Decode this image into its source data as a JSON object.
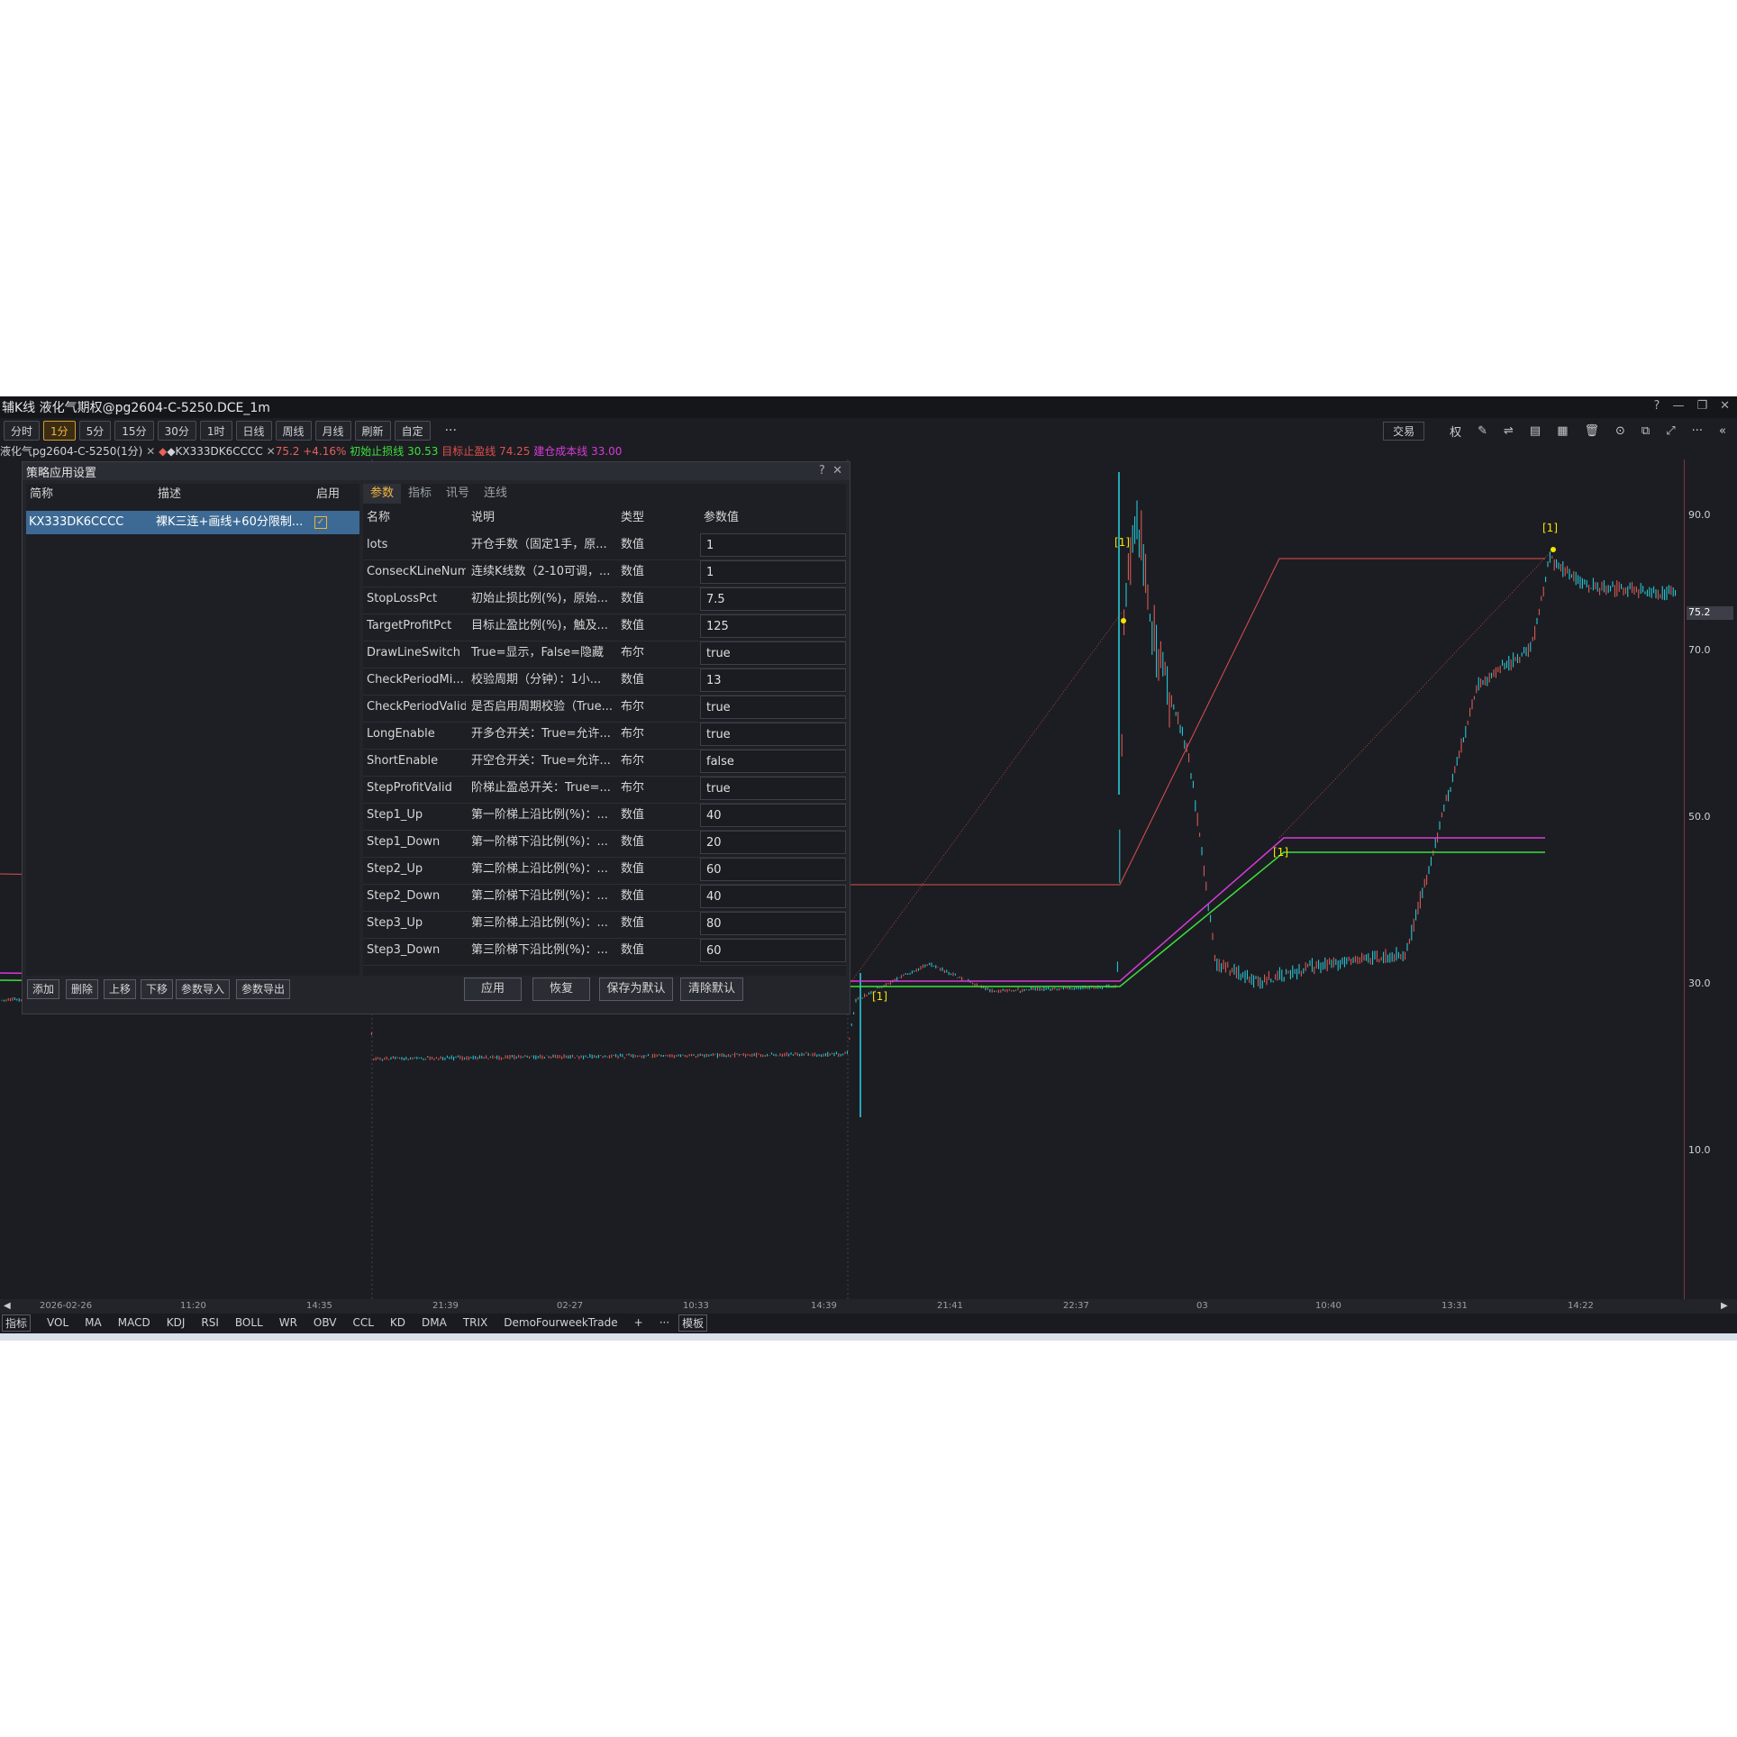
{
  "window": {
    "title": "辅K线 液化气期权@pg2604-C-5250.DCE_1m",
    "controls": [
      "?",
      "—",
      "❐",
      "✕"
    ]
  },
  "toolbar": {
    "periods": [
      "分时",
      "1分",
      "5分",
      "15分",
      "30分",
      "1时",
      "日线",
      "周线",
      "月线",
      "刷新",
      "自定"
    ],
    "active_period": "1分",
    "more": "···",
    "trade_label": "交易",
    "right_icons": [
      "权",
      "✎",
      "⇌",
      "▤",
      "▦",
      "🗑",
      "⊙",
      "⧉",
      "⤢",
      "···",
      "«"
    ]
  },
  "legend": {
    "instrument": "液化气pg2604-C-5250(1分)",
    "strategy": "◆KX333DK6CCCC",
    "price": "75.2",
    "change": "+4.16%",
    "stop_loss_label": "初始止损线 30.53",
    "target_label": "目标止盈线 74.25",
    "cost_label": "建仓成本线 33.00"
  },
  "yaxis": {
    "labels": [
      "90.0",
      "70.0",
      "50.0",
      "30.0",
      "10.0"
    ],
    "current": "75.2"
  },
  "xaxis": {
    "labels": [
      "2026-02-26",
      "11:20",
      "14:35",
      "21:39",
      "02-27",
      "10:33",
      "14:39",
      "21:41",
      "22:37",
      "03",
      "10:40",
      "13:31",
      "14:22"
    ]
  },
  "chart": {
    "signal_label": "[1]"
  },
  "bottombar": {
    "indicator_tag": "指标",
    "indicators": [
      "VOL",
      "MA",
      "MACD",
      "KDJ",
      "RSI",
      "BOLL",
      "WR",
      "OBV",
      "CCL",
      "KD",
      "DMA",
      "TRIX",
      "DemoFourweekTrade"
    ],
    "add": "+",
    "more": "···",
    "template_tag": "模板"
  },
  "dialog": {
    "title": "策略应用设置",
    "help": "?",
    "close": "✕",
    "left_headers": [
      "简称",
      "描述",
      "启用"
    ],
    "strategy_row": {
      "name": "KX333DK6CCCC",
      "desc": "裸K三连+画线+60分限制...",
      "enabled": "✓"
    },
    "left_buttons": [
      "添加",
      "删除",
      "上移",
      "下移",
      "参数导入",
      "参数导出"
    ],
    "tabs": [
      "参数",
      "指标",
      "讯号",
      "连线"
    ],
    "param_headers": [
      "名称",
      "说明",
      "类型",
      "参数值"
    ],
    "params": [
      {
        "name": "lots",
        "desc": "开仓手数（固定1手，原...",
        "type": "数值",
        "value": "1"
      },
      {
        "name": "ConsecKLineNum",
        "desc": "连续K线数（2-10可调，...",
        "type": "数值",
        "value": "1"
      },
      {
        "name": "StopLossPct",
        "desc": "初始止损比例(%)，原始...",
        "type": "数值",
        "value": "7.5"
      },
      {
        "name": "TargetProfitPct",
        "desc": "目标止盈比例(%)，触及...",
        "type": "数值",
        "value": "125"
      },
      {
        "name": "DrawLineSwitch",
        "desc": "True=显示，False=隐藏",
        "type": "布尔",
        "value": "true"
      },
      {
        "name": "CheckPeriodMi...",
        "desc": "校验周期（分钟）：1小...",
        "type": "数值",
        "value": "13"
      },
      {
        "name": "CheckPeriodValid",
        "desc": "是否启用周期校验（True...",
        "type": "布尔",
        "value": "true"
      },
      {
        "name": "LongEnable",
        "desc": "开多仓开关：True=允许...",
        "type": "布尔",
        "value": "true"
      },
      {
        "name": "ShortEnable",
        "desc": "开空仓开关：True=允许...",
        "type": "布尔",
        "value": "false"
      },
      {
        "name": "StepProfitValid",
        "desc": "阶梯止盈总开关：True=...",
        "type": "布尔",
        "value": "true"
      },
      {
        "name": "Step1_Up",
        "desc": "第一阶梯上沿比例(%)：...",
        "type": "数值",
        "value": "40"
      },
      {
        "name": "Step1_Down",
        "desc": "第一阶梯下沿比例(%)：...",
        "type": "数值",
        "value": "20"
      },
      {
        "name": "Step2_Up",
        "desc": "第二阶梯上沿比例(%)：...",
        "type": "数值",
        "value": "60"
      },
      {
        "name": "Step2_Down",
        "desc": "第二阶梯下沿比例(%)：...",
        "type": "数值",
        "value": "40"
      },
      {
        "name": "Step3_Up",
        "desc": "第三阶梯上沿比例(%)：...",
        "type": "数值",
        "value": "80"
      },
      {
        "name": "Step3_Down",
        "desc": "第三阶梯下沿比例(%)：...",
        "type": "数值",
        "value": "60"
      }
    ],
    "right_buttons": [
      "应用",
      "恢复",
      "保存为默认",
      "清除默认"
    ]
  },
  "colors": {
    "up": "#e8605a",
    "down": "#27d6e6",
    "magenta": "#d63bd8",
    "green": "#3de03d",
    "red_line": "#e05050",
    "signal": "#f5e600"
  }
}
